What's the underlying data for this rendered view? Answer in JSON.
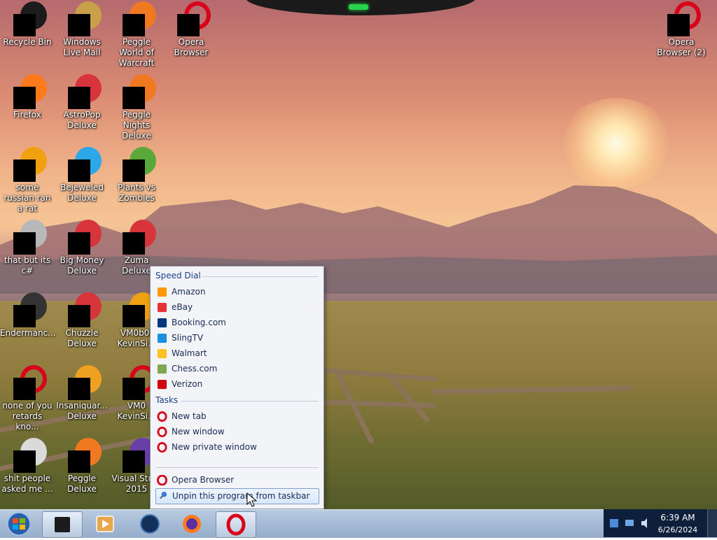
{
  "desktop_icons": [
    {
      "label": "Recycle Bin",
      "icon": "recycle-bin-icon"
    },
    {
      "label": "Windows Live Mail",
      "icon": "mail-icon"
    },
    {
      "label": "Peggle World of Warcraft",
      "icon": "peggle-icon"
    },
    {
      "label": "Opera Browser",
      "icon": "opera-icon"
    },
    {
      "label": "Opera Browser (2)",
      "icon": "opera-icon"
    },
    {
      "label": "Firefox",
      "icon": "firefox-icon"
    },
    {
      "label": "AstroPop Deluxe",
      "icon": "game-icon"
    },
    {
      "label": "Peggle Nights Deluxe",
      "icon": "peggle-icon"
    },
    {
      "label": "some russian ran a rat",
      "icon": "file-icon"
    },
    {
      "label": "Bejeweled Deluxe",
      "icon": "gem-icon"
    },
    {
      "label": "Plants vs Zombies",
      "icon": "plant-icon"
    },
    {
      "label": "that but its c#",
      "icon": "folder-icon"
    },
    {
      "label": "Big Money Deluxe",
      "icon": "game-icon"
    },
    {
      "label": "Zuma Deluxe",
      "icon": "game-icon"
    },
    {
      "label": "Endermanc...",
      "icon": "terminal-icon"
    },
    {
      "label": "Chuzzle Deluxe",
      "icon": "game-icon"
    },
    {
      "label": "VM0b0t KevinSi...",
      "icon": "file-icon"
    },
    {
      "label": "none of you retards kno...",
      "icon": "opera-icon"
    },
    {
      "label": "Insaniquar... Deluxe",
      "icon": "fish-icon"
    },
    {
      "label": "VM0 KevinSi...",
      "icon": "opera-icon"
    },
    {
      "label": "shit people asked me ...",
      "icon": "document-icon"
    },
    {
      "label": "Peggle Deluxe",
      "icon": "peggle-icon"
    },
    {
      "label": "Visual Stu... 2015",
      "icon": "visual-studio-icon"
    }
  ],
  "jumplist": {
    "speed_dial_header": "Speed Dial",
    "speed_dial": [
      {
        "label": "Amazon",
        "icon": "amazon-icon",
        "color": "#ff9900"
      },
      {
        "label": "eBay",
        "icon": "ebay-icon",
        "color": "#e53238"
      },
      {
        "label": "Booking.com",
        "icon": "booking-icon",
        "color": "#003580"
      },
      {
        "label": "SlingTV",
        "icon": "slingtv-icon",
        "color": "#1a8fe0"
      },
      {
        "label": "Walmart",
        "icon": "walmart-icon",
        "color": "#ffc220"
      },
      {
        "label": "Chess.com",
        "icon": "chess-icon",
        "color": "#7fa650"
      },
      {
        "label": "Verizon",
        "icon": "verizon-icon",
        "color": "#cd040b"
      }
    ],
    "tasks_header": "Tasks",
    "tasks": [
      {
        "label": "New tab",
        "icon": "opera-icon"
      },
      {
        "label": "New window",
        "icon": "opera-icon"
      },
      {
        "label": "New private window",
        "icon": "opera-icon"
      }
    ],
    "app_item": {
      "label": "Opera Browser",
      "icon": "opera-icon"
    },
    "unpin_item": {
      "label": "Unpin this program from taskbar",
      "icon": "pin-icon"
    }
  },
  "taskbar": {
    "items": [
      {
        "name": "start-button",
        "icon": "windows-orb-icon"
      },
      {
        "name": "taskbar-app-1",
        "icon": "app-window-icon"
      },
      {
        "name": "taskbar-media-player",
        "icon": "media-player-icon"
      },
      {
        "name": "taskbar-app-globe",
        "icon": "globe-icon"
      },
      {
        "name": "taskbar-firefox",
        "icon": "firefox-icon"
      },
      {
        "name": "taskbar-opera",
        "icon": "opera-icon"
      }
    ],
    "clock_time": "6:39 AM",
    "clock_date": "6/26/2024"
  },
  "colors": {
    "opera_red": "#d8001a",
    "jumplist_header": "#1e3f8a",
    "tray_bg": "#0e1f3c"
  }
}
